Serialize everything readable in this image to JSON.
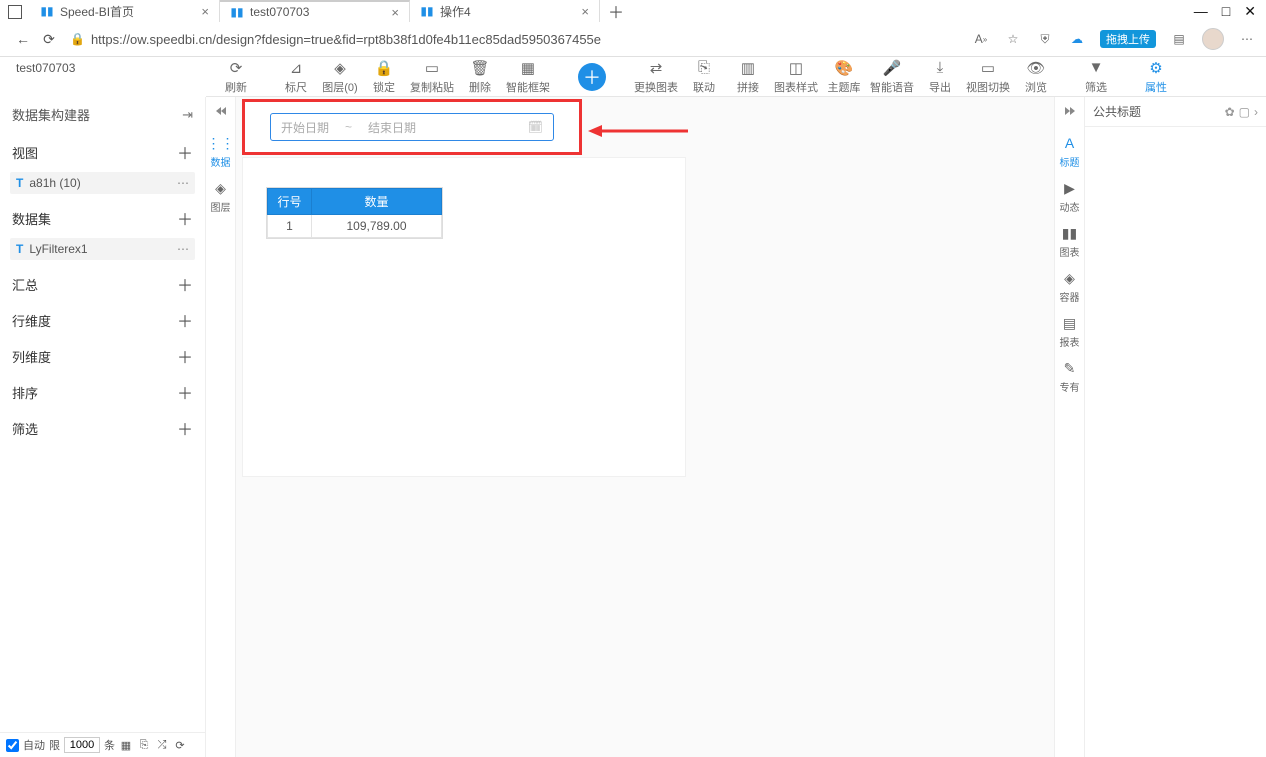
{
  "browser": {
    "tabs": [
      {
        "label": "Speed-BI首页",
        "active": false
      },
      {
        "label": "test070703",
        "active": true
      },
      {
        "label": "操作4",
        "active": false
      }
    ],
    "url": "https://ow.speedbi.cn/design?fdesign=true&fid=rpt8b38f1d0fe4b11ec85dad5950367455e",
    "upload_pill": "拖拽上传"
  },
  "doc_title": "test070703",
  "toolbar": {
    "refresh": "刷新",
    "ruler": "标尺",
    "layer": "图层(0)",
    "lock": "锁定",
    "copy_paste": "复制粘贴",
    "delete": "删除",
    "smart_frame": "智能框架",
    "change_chart": "更换图表",
    "link": "联动",
    "join": "拼接",
    "chart_style": "图表样式",
    "theme": "主题库",
    "voice": "智能语音",
    "export": "导出",
    "view_switch": "视图切换",
    "preview": "浏览",
    "filter": "筛选",
    "property": "属性"
  },
  "left_panel": {
    "header": "数据集构建器",
    "sections": {
      "view": {
        "title": "视图",
        "items": [
          "a81h (10)"
        ]
      },
      "dataset": {
        "title": "数据集",
        "items": [
          "LyFilterex1"
        ]
      },
      "summary": "汇总",
      "row_dim": "行维度",
      "col_dim": "列维度",
      "sort": "排序",
      "filter": "筛选"
    },
    "footer": {
      "auto": "自动",
      "limit_label": "限",
      "limit_value": "1000",
      "unit": "条"
    }
  },
  "left_rail": [
    {
      "label": "数据",
      "active": true
    },
    {
      "label": "图层",
      "active": false
    }
  ],
  "canvas": {
    "date_start_placeholder": "开始日期",
    "date_sep": "~",
    "date_end_placeholder": "结束日期",
    "table": {
      "headers": [
        "行号",
        "数量"
      ],
      "rows": [
        [
          "1",
          "109,789.00"
        ]
      ]
    }
  },
  "right_rail": [
    {
      "label": "标题",
      "active": true
    },
    {
      "label": "动态",
      "active": false
    },
    {
      "label": "图表",
      "active": false
    },
    {
      "label": "容器",
      "active": false
    },
    {
      "label": "报表",
      "active": false
    },
    {
      "label": "专有",
      "active": false
    }
  ],
  "right_panel": {
    "title": "公共标题"
  }
}
